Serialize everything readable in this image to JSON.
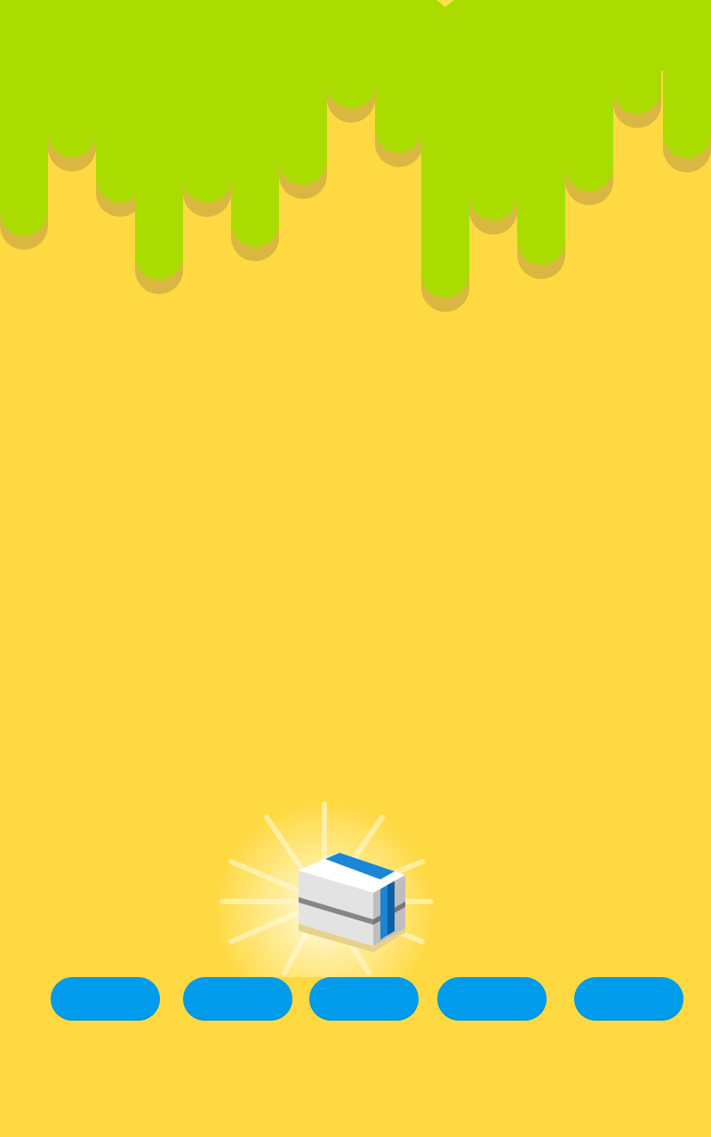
{
  "colors": {
    "background": "#FFD942",
    "slime": "#AADC00",
    "slime_shadow": "#D9B740",
    "platform": "#009BEA",
    "box_face_light": "#F2F2F2",
    "box_face_shade": "#C9C9C9",
    "box_stripe": "#1A86D6",
    "glow": "#FFF7C8",
    "star": "#FFE24A"
  },
  "scene": {
    "platforms": [
      {
        "name": "platform-1"
      },
      {
        "name": "platform-2"
      },
      {
        "name": "platform-3"
      },
      {
        "name": "platform-4"
      },
      {
        "name": "platform-5"
      }
    ],
    "player": {
      "icon": "gift-box-icon",
      "glowing": true
    },
    "hazard": {
      "icon": "slime-drips"
    },
    "collectible_peek": {
      "icon": "star-icon"
    }
  }
}
